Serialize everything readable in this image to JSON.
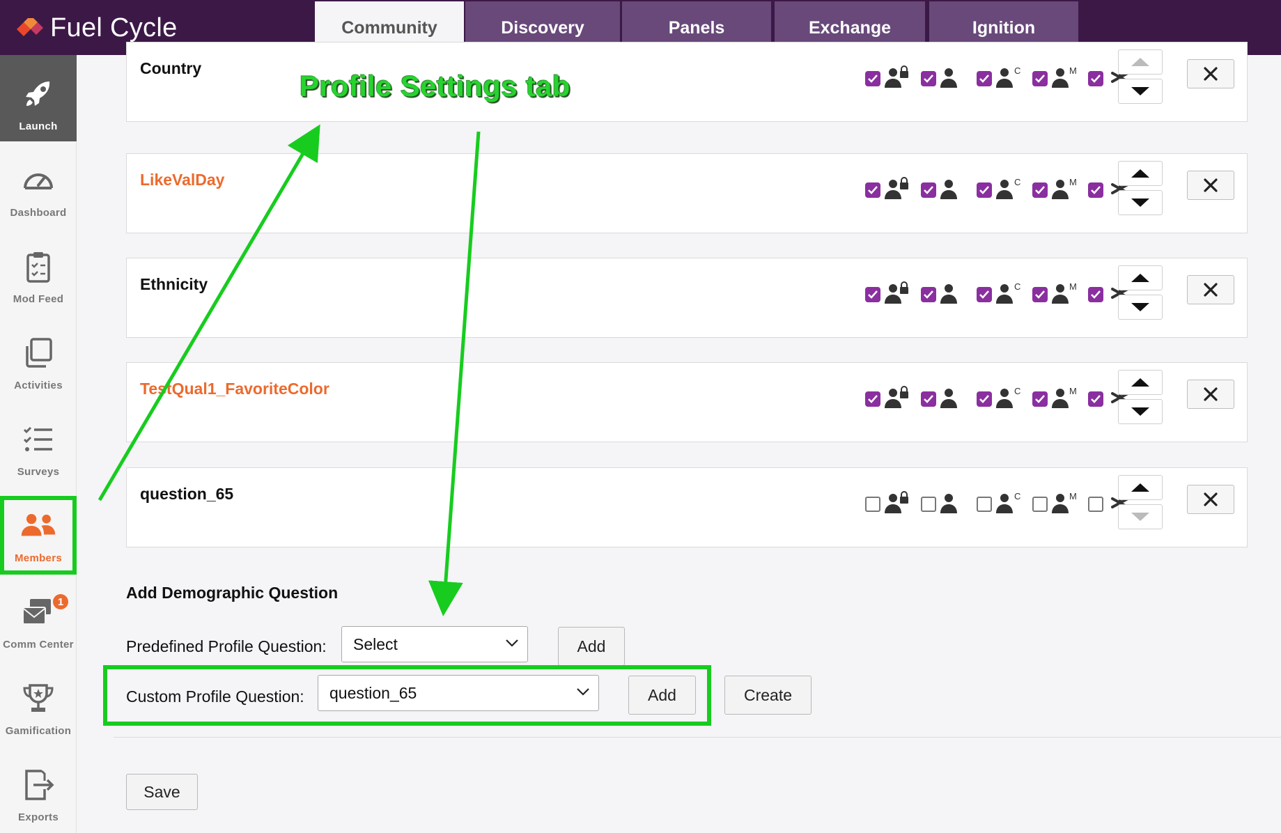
{
  "app": {
    "name": "Fuel Cycle"
  },
  "tabs": [
    {
      "label": "Community",
      "active": true
    },
    {
      "label": "Discovery",
      "active": false
    },
    {
      "label": "Panels",
      "active": false
    },
    {
      "label": "Exchange",
      "active": false
    },
    {
      "label": "Ignition",
      "active": false
    }
  ],
  "sidebar": {
    "items": [
      {
        "label": "Launch",
        "icon": "rocket-icon"
      },
      {
        "label": "Dashboard",
        "icon": "gauge-icon"
      },
      {
        "label": "Mod Feed",
        "icon": "clipboard-icon"
      },
      {
        "label": "Activities",
        "icon": "copy-icon"
      },
      {
        "label": "Surveys",
        "icon": "checklist-icon"
      },
      {
        "label": "Members",
        "icon": "members-icon"
      },
      {
        "label": "Comm Center",
        "icon": "comm-center-icon",
        "badge": "1"
      },
      {
        "label": "Gamification",
        "icon": "trophy-icon"
      },
      {
        "label": "Exports",
        "icon": "export-icon"
      }
    ]
  },
  "questions": [
    {
      "title": "Country",
      "highlight": false,
      "checked": true,
      "up_enabled": false,
      "down_enabled": true
    },
    {
      "title": "LikeValDay",
      "highlight": true,
      "checked": true,
      "up_enabled": true,
      "down_enabled": true
    },
    {
      "title": "Ethnicity",
      "highlight": false,
      "checked": true,
      "up_enabled": true,
      "down_enabled": true
    },
    {
      "title": "TestQual1_FavoriteColor",
      "highlight": true,
      "checked": true,
      "up_enabled": true,
      "down_enabled": true
    },
    {
      "title": "question_65",
      "highlight": false,
      "checked": false,
      "up_enabled": true,
      "down_enabled": false
    }
  ],
  "perm_icons": [
    "locked-member-icon",
    "member-icon",
    "member-c-icon",
    "member-m-icon",
    "required-asterisk-icon"
  ],
  "add_section": {
    "title": "Add Demographic Question",
    "predefined_label": "Predefined Profile Question:",
    "predefined_value": "Select",
    "predefined_add": "Add",
    "custom_label": "Custom Profile Question:",
    "custom_value": "question_65",
    "custom_add": "Add",
    "create": "Create",
    "save": "Save"
  },
  "annotation": {
    "text": "Profile Settings tab",
    "color": "#17cc1f"
  },
  "colors": {
    "topbar": "#3c1847",
    "tab": "#68497a",
    "accent_orange": "#ec6a2d",
    "checkbox": "#8a2f9f"
  }
}
